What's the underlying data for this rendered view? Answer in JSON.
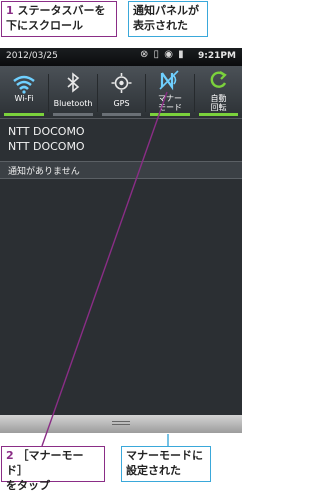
{
  "callouts": {
    "step1_num": "1",
    "step1_text": "ステータスバーを\n下にスクロール",
    "result1": "通知パネルが\n表示された",
    "step2_num": "2",
    "step2_text": "［マナーモード］\nをタップ",
    "result2": "マナーモードに\n設定された"
  },
  "status_bar": {
    "date": "2012/03/25",
    "time": "9:21PM"
  },
  "toggles": [
    {
      "label": "Wi-Fi",
      "icon": "wifi-icon",
      "on": true
    },
    {
      "label": "Bluetooth",
      "icon": "bluetooth-icon",
      "on": false
    },
    {
      "label": "GPS",
      "icon": "gps-icon",
      "on": false
    },
    {
      "label": "マナー\nモード",
      "icon": "silent-mode-icon",
      "on": true
    },
    {
      "label": "自動\n回転",
      "icon": "auto-rotate-icon",
      "on": true
    }
  ],
  "carrier": {
    "line1": "NTT DOCOMO",
    "line2": "NTT DOCOMO"
  },
  "notifications": {
    "empty_text": "通知がありません"
  },
  "colors": {
    "accent": "#8a2d86",
    "info": "#3aa8da",
    "toggle_on": "#7bd23c",
    "icon_on": "#6fd0ff"
  }
}
